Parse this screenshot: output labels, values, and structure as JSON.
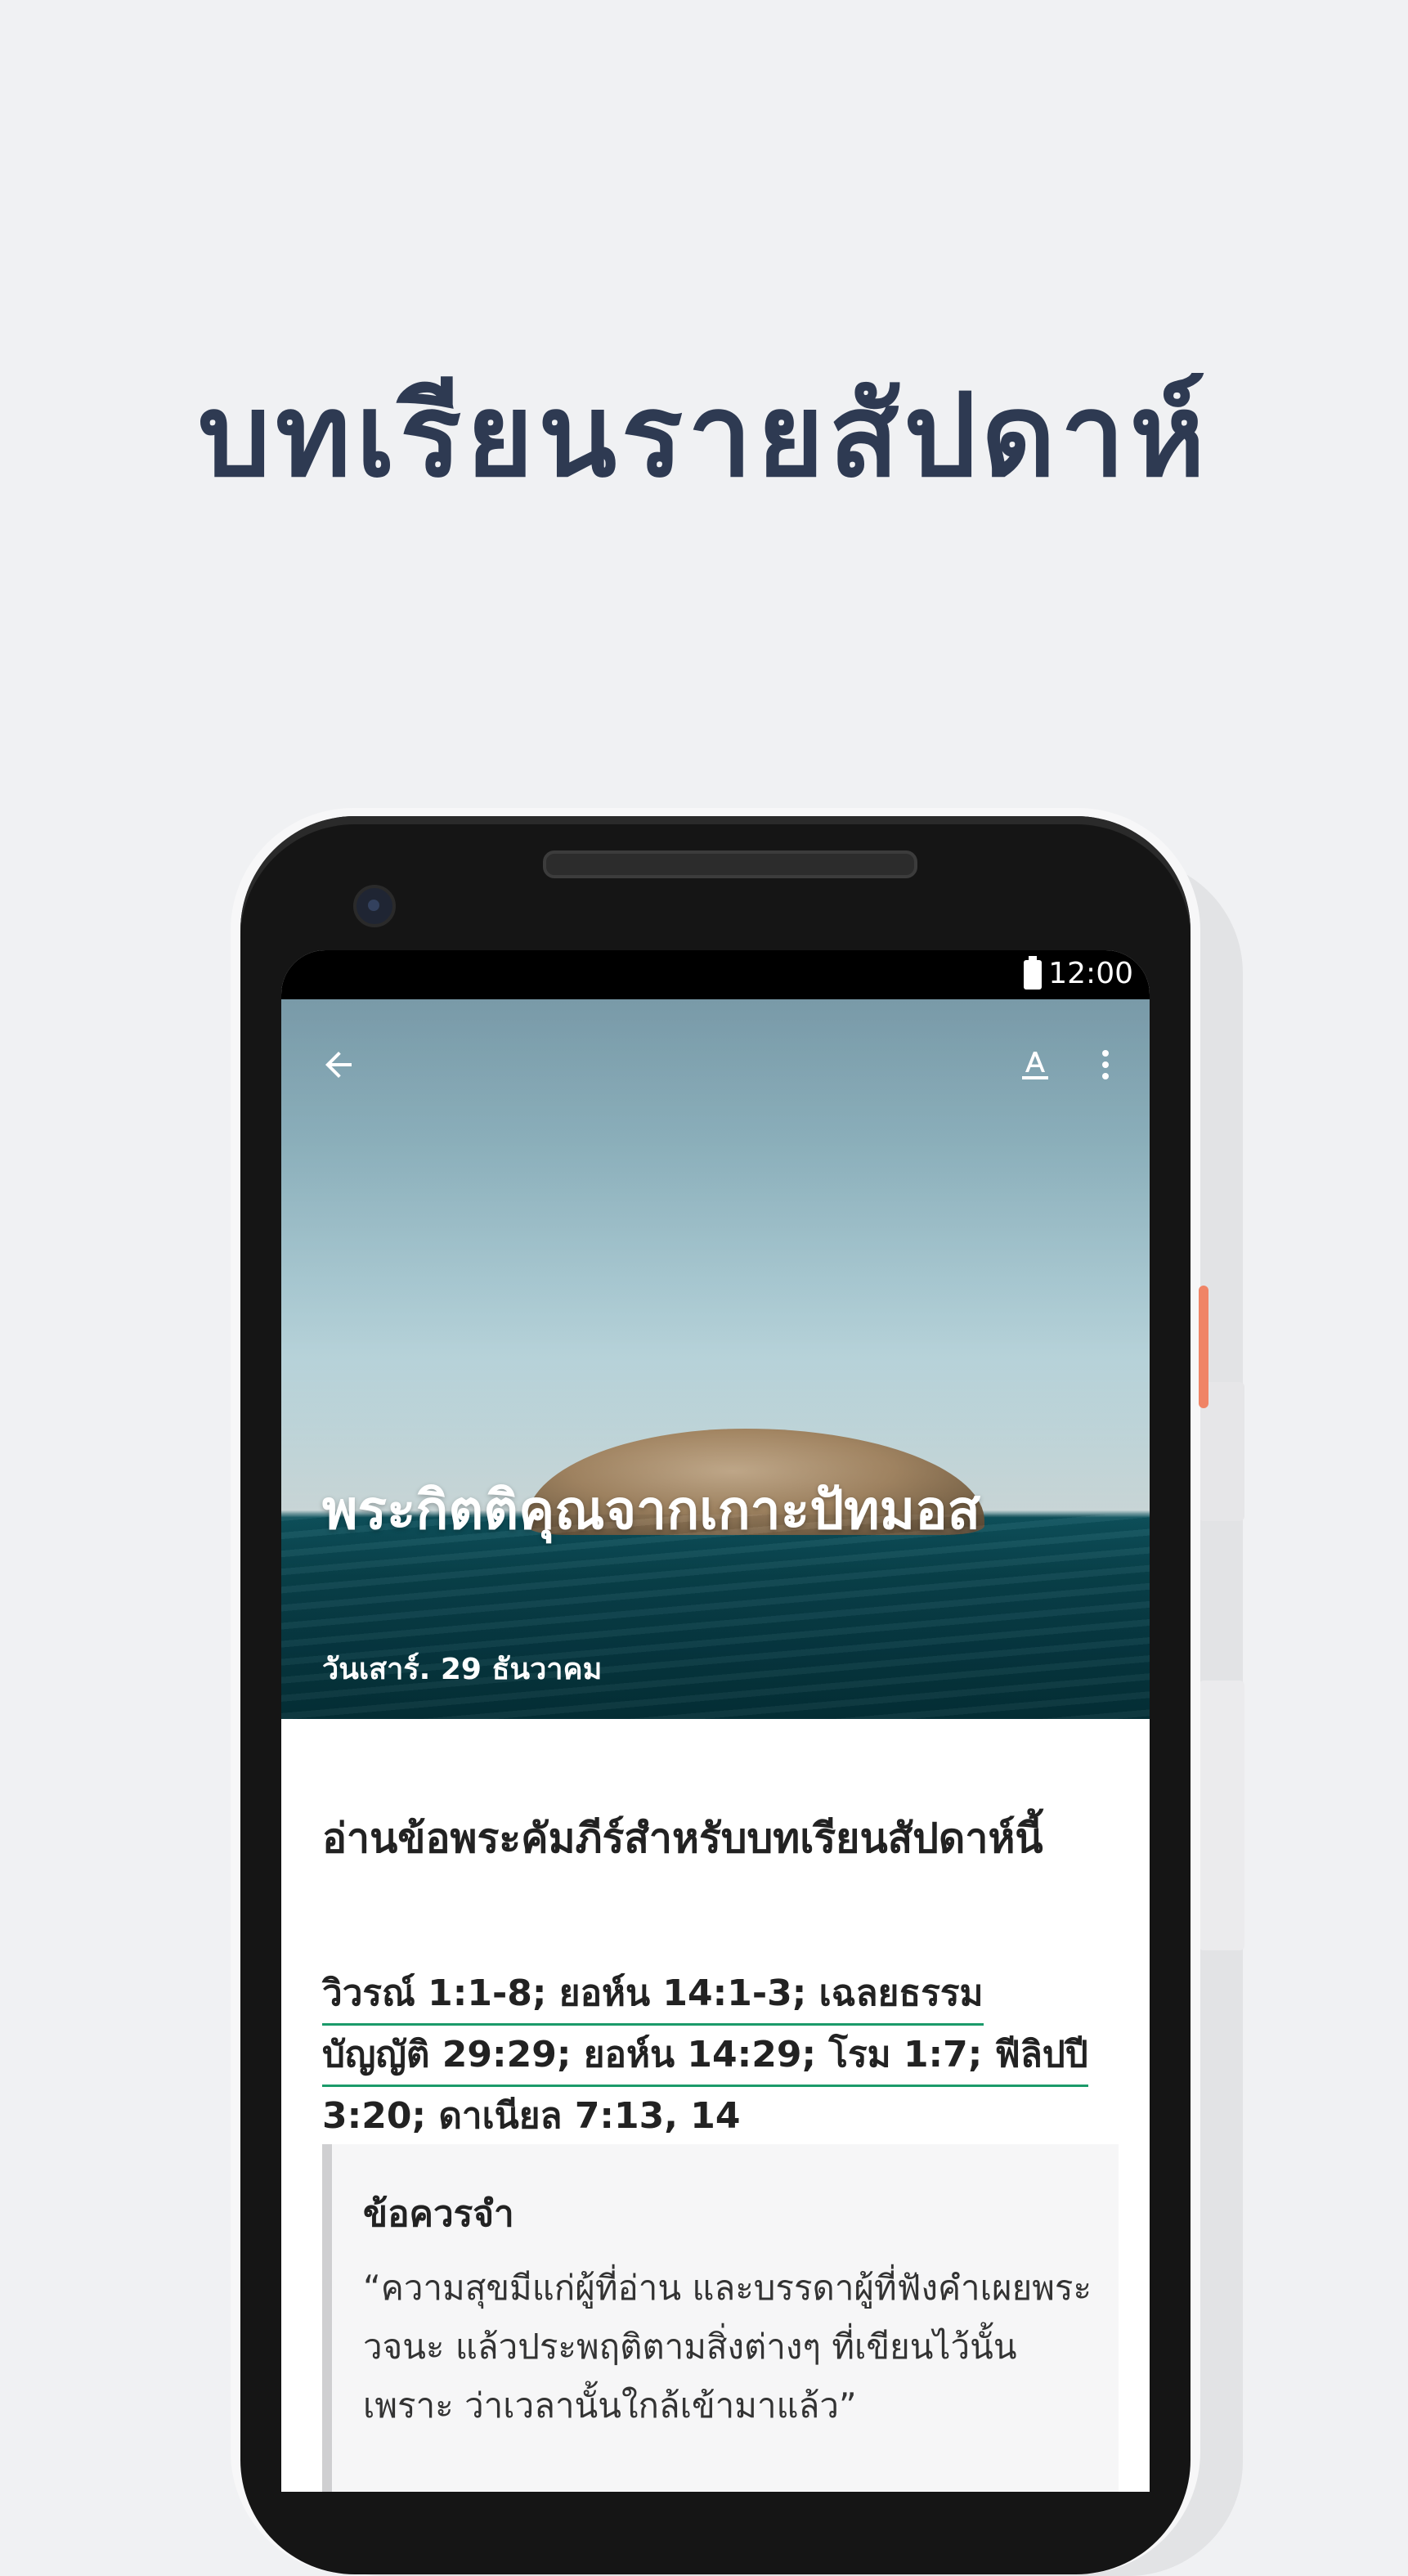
{
  "headline": "บทเรียนรายสัปดาห์",
  "status_bar": {
    "time": "12:00"
  },
  "icons": {
    "back": "arrow-left-icon",
    "font": "text-format-icon",
    "more": "more-vertical-icon"
  },
  "lesson": {
    "title": "พระกิตติคุณจากเกาะปัทมอส",
    "date": "วันเสาร์. 29 ธันวาคม"
  },
  "reading": {
    "heading": "อ่านข้อพระคัมภีร์สำหรับบทเรียนสัปดาห์นี้",
    "refs": [
      "วิวรณ์ 1:1-8; ยอห์น 14:1-3; เฉลยธรรม",
      "บัญญัติ 29:29; ยอห์น 14:29; โรม 1:7; ฟีลิปปี",
      "3:20; ดาเนียล 7:13, 14"
    ]
  },
  "memory": {
    "title": "ข้อควรจำ",
    "text": "“ความสุขมีแก่ผู้ที่อ่าน และบรรดาผู้ที่ฟังคำเผยพระวจนะ แล้วประพฤติตามสิ่งต่างๆ ที่เขียนไว้นั้น เพราะ ว่าเวลานั้นใกล้เข้ามาแล้ว”"
  }
}
